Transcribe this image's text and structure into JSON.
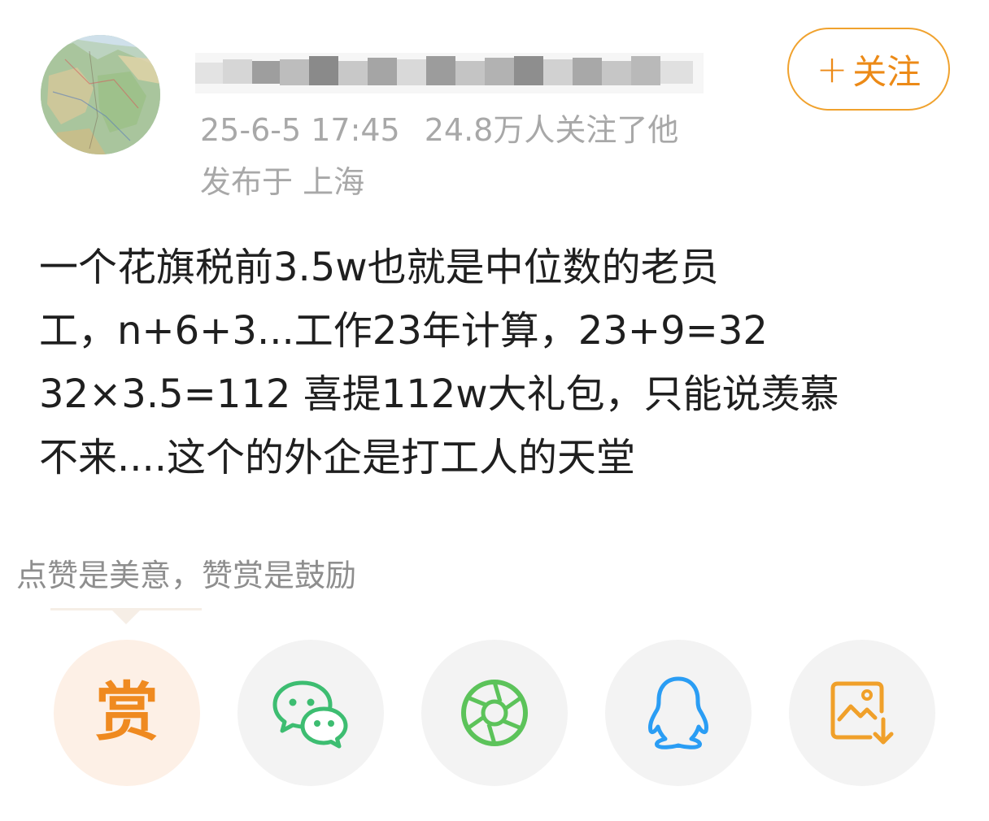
{
  "header": {
    "meta_time": "25-6-5 17:45",
    "meta_followers": "24.8万人关注了他",
    "meta_location": "发布于 上海",
    "follow_plus": "+",
    "follow_label": "关注"
  },
  "post": {
    "lines": [
      "一个花旗税前3.5w也就是中位数的老员",
      "工，n+6+3...工作23年计算，23+9=32",
      "32×3.5=112  喜提112w大礼包，只能说羡慕",
      "不来....这个的外企是打工人的天堂"
    ]
  },
  "reward_tip": "点赞是美意，赞赏是鼓励",
  "actions": {
    "reward_char": "赏",
    "icons": [
      "wechat-icon",
      "moments-icon",
      "qq-icon",
      "save-image-icon"
    ],
    "colors": {
      "reward": "#ef8a20",
      "wechat": "#3dbd71",
      "moments": "#5cc35a",
      "qq": "#2a9df4",
      "save_image": "#f0a02a"
    }
  },
  "colors": {
    "accent": "#ec8a17",
    "meta_text": "#a8a8a8",
    "body_text": "#1f1f1f"
  }
}
